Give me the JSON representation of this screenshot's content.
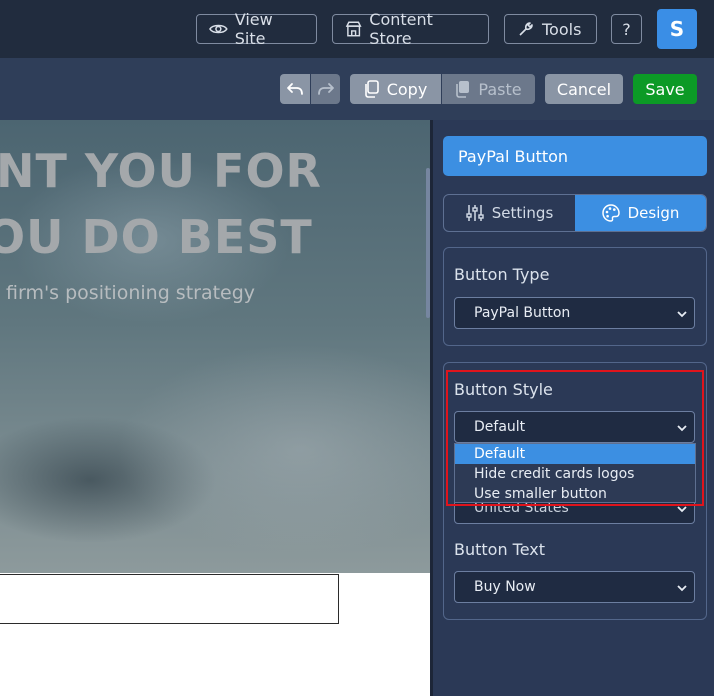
{
  "topbar": {
    "view_site": "View Site",
    "content_store": "Content Store",
    "tools": "Tools",
    "help": "?",
    "avatar": "S"
  },
  "toolbar": {
    "copy": "Copy",
    "paste": "Paste",
    "cancel": "Cancel",
    "save": "Save"
  },
  "hero": {
    "line1": "NT YOU FOR",
    "line2": "OU DO BEST",
    "subtitle": "firm's positioning strategy"
  },
  "sidebar": {
    "title": "PayPal Button",
    "tabs": {
      "settings": "Settings",
      "design": "Design"
    },
    "button_type": {
      "label": "Button Type",
      "value": "PayPal Button"
    },
    "button_style": {
      "label": "Button Style",
      "value": "Default",
      "options": [
        "Default",
        "Hide credit cards logos",
        "Use smaller button"
      ]
    },
    "country": {
      "value": "United States"
    },
    "button_text": {
      "label": "Button Text",
      "value": "Buy Now"
    }
  },
  "colors": {
    "accent": "#3c8fe2",
    "save": "#0c9a26",
    "highlight": "#e0141c"
  }
}
